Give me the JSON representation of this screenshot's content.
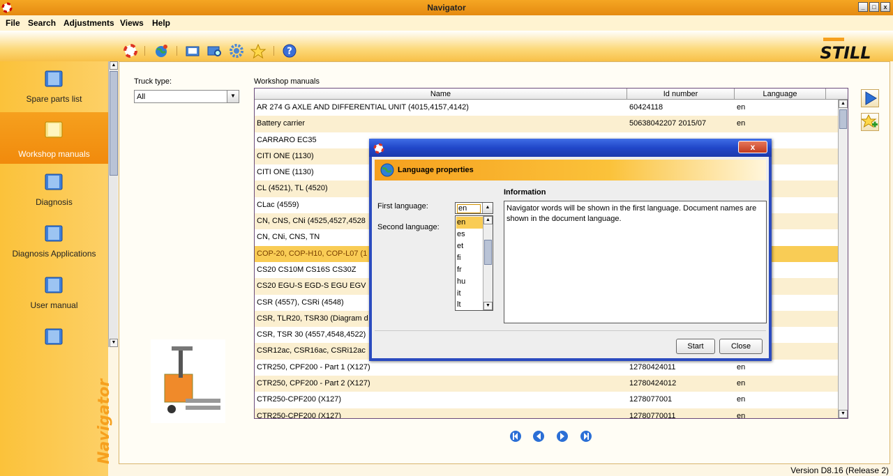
{
  "window": {
    "title": "Navigator",
    "min_label": "_",
    "max_label": "□",
    "close_label": "x"
  },
  "menu": [
    "File",
    "Search",
    "Adjustments",
    "Views",
    "Help"
  ],
  "toolbar": {
    "icons": [
      "lifebuoy-icon",
      "globe-icon",
      "book-icon",
      "search-book-icon",
      "gear-icon",
      "star-icon",
      "help-icon"
    ]
  },
  "brand": {
    "logo_text": "STILL",
    "vertical_label": "Navigator",
    "accent": "#f6a01e",
    "logo_color": "#111111"
  },
  "sidebar": {
    "items": [
      {
        "label": "Spare parts list",
        "active": false
      },
      {
        "label": "Workshop manuals",
        "active": true
      },
      {
        "label": "Diagnosis",
        "active": false
      },
      {
        "label": "Diagnosis Applications",
        "active": false
      },
      {
        "label": "User manual",
        "active": false
      },
      {
        "label": "",
        "active": false
      }
    ]
  },
  "filter": {
    "label": "Truck type:",
    "value": "All"
  },
  "manuals": {
    "title": "Workshop manuals",
    "columns": [
      "Name",
      "Id number",
      "Language"
    ],
    "rows": [
      {
        "name": "AR 274 G AXLE AND DIFFERENTIAL UNIT (4015,4157,4142)",
        "id": "60424118",
        "lang": "en"
      },
      {
        "name": "Battery carrier",
        "id": "50638042207  2015/07",
        "lang": "en"
      },
      {
        "name": "CARRARO EC35",
        "id": "",
        "lang": ""
      },
      {
        "name": "CITI ONE (1130)",
        "id": "",
        "lang": ""
      },
      {
        "name": "CITI ONE (1130)",
        "id": "",
        "lang": ""
      },
      {
        "name": "CL (4521), TL (4520)",
        "id": "",
        "lang": ""
      },
      {
        "name": "CLac (4559)",
        "id": "",
        "lang": ""
      },
      {
        "name": "CN, CNS, CNi (4525,4527,4528",
        "id": "",
        "lang": ""
      },
      {
        "name": "CN, CNi, CNS, TN",
        "id": "",
        "lang": ""
      },
      {
        "name": "COP-20, COP-H10, COP-L07 (1",
        "id": "",
        "lang": ""
      },
      {
        "name": "CS20 CS10M CS16S CS30Z",
        "id": "",
        "lang": ""
      },
      {
        "name": "CS20 EGU-S EGD-S EGU EGV",
        "id": "",
        "lang": ""
      },
      {
        "name": "CSR (4557), CSRi (4548)",
        "id": "",
        "lang": ""
      },
      {
        "name": "CSR, TLR20, TSR30 (Diagram d",
        "id": "",
        "lang": ""
      },
      {
        "name": "CSR, TSR 30 (4557,4548,4522)",
        "id": "",
        "lang": ""
      },
      {
        "name": "CSR12ac, CSR16ac, CSRi12ac",
        "id": "",
        "lang": ""
      },
      {
        "name": "CTR250, CPF200 - Part 1 (X127)",
        "id": "12780424011",
        "lang": "en"
      },
      {
        "name": "CTR250, CPF200 - Part 2 (X127)",
        "id": "12780424012",
        "lang": "en"
      },
      {
        "name": "CTR250-CPF200 (X127)",
        "id": "1278077001",
        "lang": "en"
      },
      {
        "name": "CTR250-CPF200 (X127)",
        "id": "12780770011",
        "lang": "en"
      }
    ],
    "selected_index": 9
  },
  "pager": {
    "icons": [
      "first-page-icon",
      "prev-page-icon",
      "next-page-icon",
      "last-page-icon"
    ]
  },
  "version": "Version D8.16 (Release 2)",
  "dialog": {
    "header": "Language properties",
    "close_label": "x",
    "first_language_label": "First language:",
    "second_language_label": "Second language:",
    "first_language_value": "en",
    "language_options": [
      "en",
      "es",
      "et",
      "fi",
      "fr",
      "hu",
      "it",
      "lt"
    ],
    "info_title": "Information",
    "info_text": "Navigator words will be shown in the first language. Document names are shown in the document language.",
    "start_label": "Start",
    "close_button_label": "Close"
  }
}
